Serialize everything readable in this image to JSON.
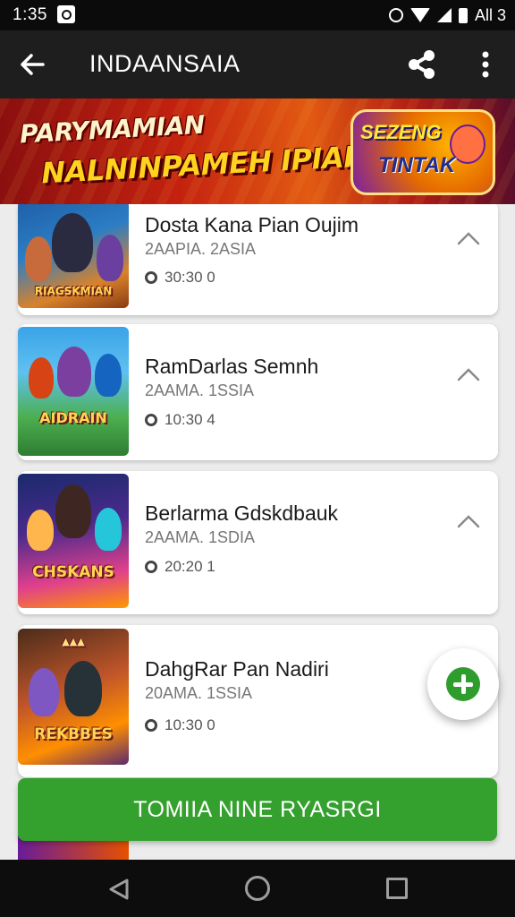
{
  "status_bar": {
    "time": "1:35",
    "right_text": "All 3",
    "icons": [
      "notification-icon",
      "alarm-icon",
      "wifi-icon",
      "signal-icon",
      "battery-icon"
    ]
  },
  "app_bar": {
    "title": "INDAANSAIA",
    "back_icon": "arrow-left-icon",
    "share_icon": "share-icon",
    "more_icon": "more-vertical-icon"
  },
  "banner": {
    "line1": "PARYMAMIAN",
    "line2": "NALNINPAMEH IPIARY!",
    "logo_line1": "SEZENG",
    "logo_line2": "TINTAK"
  },
  "items": [
    {
      "title": "Dosta Kana Pian Oujim",
      "subtitle": "2AAPIA. 2ASIA",
      "meta": "30:30 0",
      "thumb_label": "RIAGSKMIAN"
    },
    {
      "title": "RamDarlas Semnh",
      "subtitle": "2AAMA. 1SSIA",
      "meta": "10:30 4",
      "thumb_label": "AIDRAIN"
    },
    {
      "title": "Berlarma Gdskdbauk",
      "subtitle": "2AAMA. 1SDIA",
      "meta": "20:20 1",
      "thumb_label": "CHSKANS"
    },
    {
      "title": "DahgRar Pan Nadiri",
      "subtitle": "20AMA. 1SSIA",
      "meta": "10:30 0",
      "thumb_label": "REKBBES"
    }
  ],
  "fab": {
    "icon": "plus-icon"
  },
  "cta": {
    "label": "TOMIIA NINE RYASRGI"
  },
  "colors": {
    "accent_green": "#34a12e",
    "app_bar": "#1e1e1e",
    "background": "#ececec"
  }
}
